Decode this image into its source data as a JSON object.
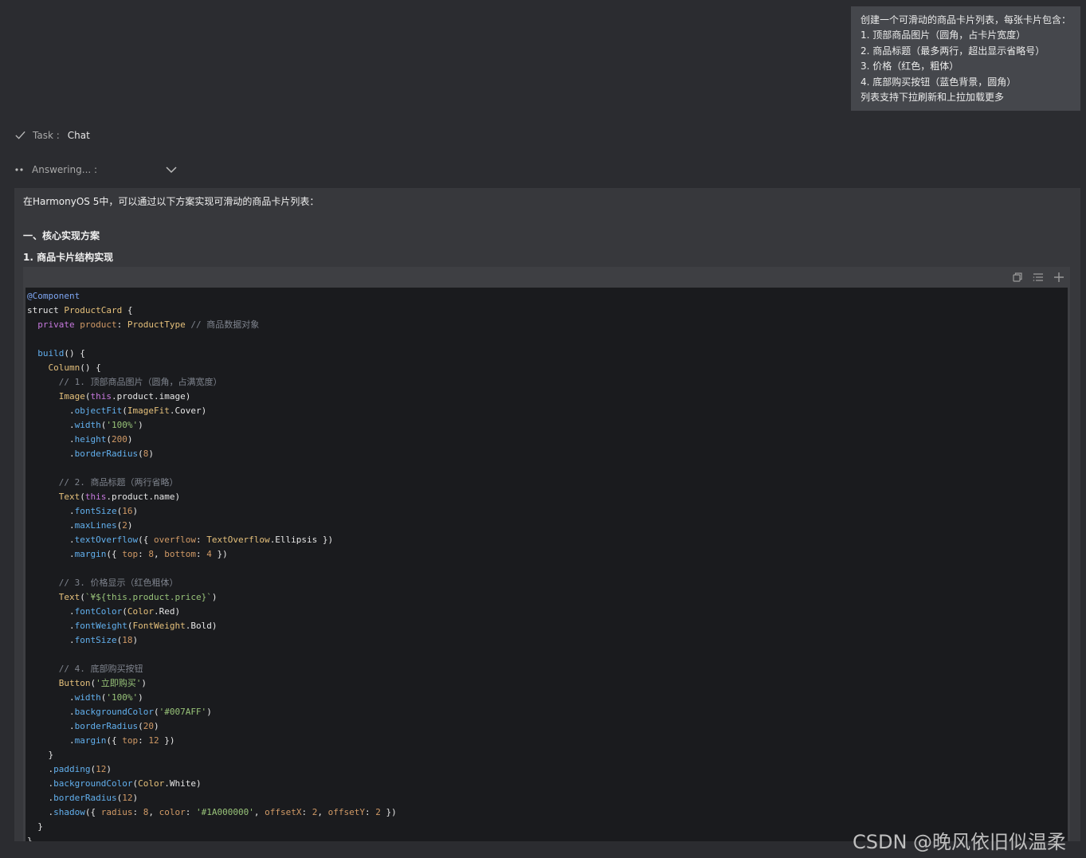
{
  "user_message": {
    "lines": [
      "创建一个可滑动的商品卡片列表，每张卡片包含：",
      "1. 顶部商品图片（圆角，占卡片宽度）",
      "2. 商品标题（最多两行，超出显示省略号）",
      "3. 价格（红色，粗体）",
      "4. 底部购买按钮（蓝色背景，圆角）",
      "列表支持下拉刷新和上拉加载更多"
    ]
  },
  "task": {
    "label": "Task :",
    "value": "Chat"
  },
  "status": {
    "label": "Answering... :"
  },
  "answer": {
    "intro": "在HarmonyOS 5中，可以通过以下方案实现可滑动的商品卡片列表：",
    "section_title": "一、核心实现方案",
    "subsection_title": "1. 商品卡片结构实现"
  },
  "code": {
    "language": "ArkTS",
    "lines": [
      [
        [
          "dec",
          "@Component"
        ]
      ],
      [
        [
          "plain",
          "struct "
        ],
        [
          "type",
          "ProductCard"
        ],
        [
          "plain",
          " {"
        ]
      ],
      [
        [
          "plain",
          "  "
        ],
        [
          "kw",
          "private"
        ],
        [
          "plain",
          " "
        ],
        [
          "prop",
          "product"
        ],
        [
          "plain",
          ": "
        ],
        [
          "type",
          "ProductType"
        ],
        [
          "plain",
          " "
        ],
        [
          "cm",
          "// 商品数据对象"
        ]
      ],
      [],
      [
        [
          "plain",
          "  "
        ],
        [
          "fn",
          "build"
        ],
        [
          "plain",
          "() {"
        ]
      ],
      [
        [
          "plain",
          "    "
        ],
        [
          "type",
          "Column"
        ],
        [
          "plain",
          "() {"
        ]
      ],
      [
        [
          "plain",
          "      "
        ],
        [
          "cm",
          "// 1. 顶部商品图片（圆角，占满宽度）"
        ]
      ],
      [
        [
          "plain",
          "      "
        ],
        [
          "type",
          "Image"
        ],
        [
          "plain",
          "("
        ],
        [
          "this",
          "this"
        ],
        [
          "plain",
          ".product.image)"
        ]
      ],
      [
        [
          "plain",
          "        ."
        ],
        [
          "method",
          "objectFit"
        ],
        [
          "plain",
          "("
        ],
        [
          "type",
          "ImageFit"
        ],
        [
          "plain",
          ".Cover)"
        ]
      ],
      [
        [
          "plain",
          "        ."
        ],
        [
          "method",
          "width"
        ],
        [
          "plain",
          "("
        ],
        [
          "str",
          "'100%'"
        ],
        [
          "plain",
          ")"
        ]
      ],
      [
        [
          "plain",
          "        ."
        ],
        [
          "method",
          "height"
        ],
        [
          "plain",
          "("
        ],
        [
          "num",
          "200"
        ],
        [
          "plain",
          ")"
        ]
      ],
      [
        [
          "plain",
          "        ."
        ],
        [
          "method",
          "borderRadius"
        ],
        [
          "plain",
          "("
        ],
        [
          "num",
          "8"
        ],
        [
          "plain",
          ")"
        ]
      ],
      [],
      [
        [
          "plain",
          "      "
        ],
        [
          "cm",
          "// 2. 商品标题（两行省略）"
        ]
      ],
      [
        [
          "plain",
          "      "
        ],
        [
          "type",
          "Text"
        ],
        [
          "plain",
          "("
        ],
        [
          "this",
          "this"
        ],
        [
          "plain",
          ".product.name)"
        ]
      ],
      [
        [
          "plain",
          "        ."
        ],
        [
          "method",
          "fontSize"
        ],
        [
          "plain",
          "("
        ],
        [
          "num",
          "16"
        ],
        [
          "plain",
          ")"
        ]
      ],
      [
        [
          "plain",
          "        ."
        ],
        [
          "method",
          "maxLines"
        ],
        [
          "plain",
          "("
        ],
        [
          "num",
          "2"
        ],
        [
          "plain",
          ")"
        ]
      ],
      [
        [
          "plain",
          "        ."
        ],
        [
          "method",
          "textOverflow"
        ],
        [
          "plain",
          "({ "
        ],
        [
          "prop",
          "overflow"
        ],
        [
          "plain",
          ": "
        ],
        [
          "type",
          "TextOverflow"
        ],
        [
          "plain",
          ".Ellipsis })"
        ]
      ],
      [
        [
          "plain",
          "        ."
        ],
        [
          "method",
          "margin"
        ],
        [
          "plain",
          "({ "
        ],
        [
          "prop",
          "top"
        ],
        [
          "plain",
          ": "
        ],
        [
          "num",
          "8"
        ],
        [
          "plain",
          ", "
        ],
        [
          "prop",
          "bottom"
        ],
        [
          "plain",
          ": "
        ],
        [
          "num",
          "4"
        ],
        [
          "plain",
          " })"
        ]
      ],
      [],
      [
        [
          "plain",
          "      "
        ],
        [
          "cm",
          "// 3. 价格显示（红色粗体）"
        ]
      ],
      [
        [
          "plain",
          "      "
        ],
        [
          "type",
          "Text"
        ],
        [
          "plain",
          "("
        ],
        [
          "str",
          "`¥${this.product.price}`"
        ],
        [
          "plain",
          ")"
        ]
      ],
      [
        [
          "plain",
          "        ."
        ],
        [
          "method",
          "fontColor"
        ],
        [
          "plain",
          "("
        ],
        [
          "type",
          "Color"
        ],
        [
          "plain",
          ".Red)"
        ]
      ],
      [
        [
          "plain",
          "        ."
        ],
        [
          "method",
          "fontWeight"
        ],
        [
          "plain",
          "("
        ],
        [
          "type",
          "FontWeight"
        ],
        [
          "plain",
          ".Bold)"
        ]
      ],
      [
        [
          "plain",
          "        ."
        ],
        [
          "method",
          "fontSize"
        ],
        [
          "plain",
          "("
        ],
        [
          "num",
          "18"
        ],
        [
          "plain",
          ")"
        ]
      ],
      [],
      [
        [
          "plain",
          "      "
        ],
        [
          "cm",
          "// 4. 底部购买按钮"
        ]
      ],
      [
        [
          "plain",
          "      "
        ],
        [
          "type",
          "Button"
        ],
        [
          "plain",
          "("
        ],
        [
          "str",
          "'立即购买'"
        ],
        [
          "plain",
          ")"
        ]
      ],
      [
        [
          "plain",
          "        ."
        ],
        [
          "method",
          "width"
        ],
        [
          "plain",
          "("
        ],
        [
          "str",
          "'100%'"
        ],
        [
          "plain",
          ")"
        ]
      ],
      [
        [
          "plain",
          "        ."
        ],
        [
          "method",
          "backgroundColor"
        ],
        [
          "plain",
          "("
        ],
        [
          "str",
          "'#007AFF'"
        ],
        [
          "plain",
          ")"
        ]
      ],
      [
        [
          "plain",
          "        ."
        ],
        [
          "method",
          "borderRadius"
        ],
        [
          "plain",
          "("
        ],
        [
          "num",
          "20"
        ],
        [
          "plain",
          ")"
        ]
      ],
      [
        [
          "plain",
          "        ."
        ],
        [
          "method",
          "margin"
        ],
        [
          "plain",
          "({ "
        ],
        [
          "prop",
          "top"
        ],
        [
          "plain",
          ": "
        ],
        [
          "num",
          "12"
        ],
        [
          "plain",
          " })"
        ]
      ],
      [
        [
          "plain",
          "    }"
        ]
      ],
      [
        [
          "plain",
          "    ."
        ],
        [
          "method",
          "padding"
        ],
        [
          "plain",
          "("
        ],
        [
          "num",
          "12"
        ],
        [
          "plain",
          ")"
        ]
      ],
      [
        [
          "plain",
          "    ."
        ],
        [
          "method",
          "backgroundColor"
        ],
        [
          "plain",
          "("
        ],
        [
          "type",
          "Color"
        ],
        [
          "plain",
          ".White)"
        ]
      ],
      [
        [
          "plain",
          "    ."
        ],
        [
          "method",
          "borderRadius"
        ],
        [
          "plain",
          "("
        ],
        [
          "num",
          "12"
        ],
        [
          "plain",
          ")"
        ]
      ],
      [
        [
          "plain",
          "    ."
        ],
        [
          "method",
          "shadow"
        ],
        [
          "plain",
          "({ "
        ],
        [
          "prop",
          "radius"
        ],
        [
          "plain",
          ": "
        ],
        [
          "num",
          "8"
        ],
        [
          "plain",
          ", "
        ],
        [
          "prop",
          "color"
        ],
        [
          "plain",
          ": "
        ],
        [
          "str",
          "'#1A000000'"
        ],
        [
          "plain",
          ", "
        ],
        [
          "prop",
          "offsetX"
        ],
        [
          "plain",
          ": "
        ],
        [
          "num",
          "2"
        ],
        [
          "plain",
          ", "
        ],
        [
          "prop",
          "offsetY"
        ],
        [
          "plain",
          ": "
        ],
        [
          "num",
          "2"
        ],
        [
          "plain",
          " })"
        ]
      ],
      [
        [
          "plain",
          "  }"
        ]
      ],
      [
        [
          "plain",
          "}"
        ]
      ]
    ]
  },
  "code_toolbar": {
    "copy_icon": "copy-icon",
    "wrap_icon": "list-icon",
    "insert_icon": "plus-icon"
  },
  "watermark": "CSDN @晚风依旧似温柔"
}
